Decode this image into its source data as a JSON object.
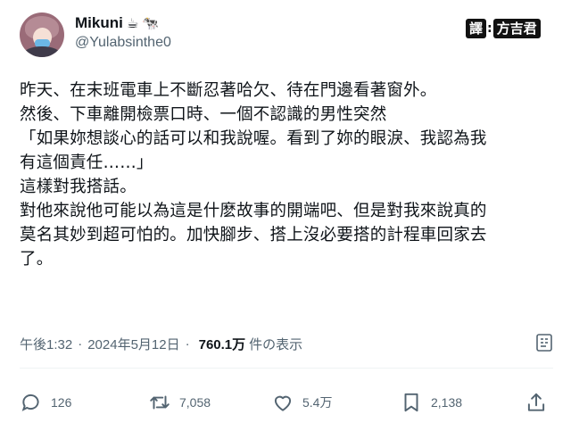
{
  "author": {
    "display_name": "Mikuni",
    "name_emojis": [
      "☕",
      "🐄"
    ],
    "handle": "@Yulabsinthe0"
  },
  "translator_badge": {
    "tag": "譯",
    "separator": ":",
    "name": "方吉君"
  },
  "tweet": {
    "lines": [
      "昨天、在末班電車上不斷忍著哈欠、待在門邊看著窗外。",
      "然後、下車離開檢票口時、一個不認識的男性突然",
      "「如果妳想談心的話可以和我說喔。看到了妳的眼淚、我認為我",
      "有這個責任……」",
      "這樣對我搭話。",
      "對他來說他可能以為這是什麽故事的開端吧、但是對我來說真的",
      "莫名其妙到超可怕的。加快腳步、搭上沒必要搭的計程車回家去",
      "了。"
    ]
  },
  "meta": {
    "time": "午後1:32",
    "separator": "·",
    "date": "2024年5月12日",
    "views_count": "760.1万",
    "views_label": "件の表示"
  },
  "actions": {
    "replies": "126",
    "reposts": "7,058",
    "likes": "5.4万",
    "bookmarks": "2,138"
  },
  "colors": {
    "text": "#0f1419",
    "secondary": "#536471",
    "divider": "#eff3f4"
  }
}
